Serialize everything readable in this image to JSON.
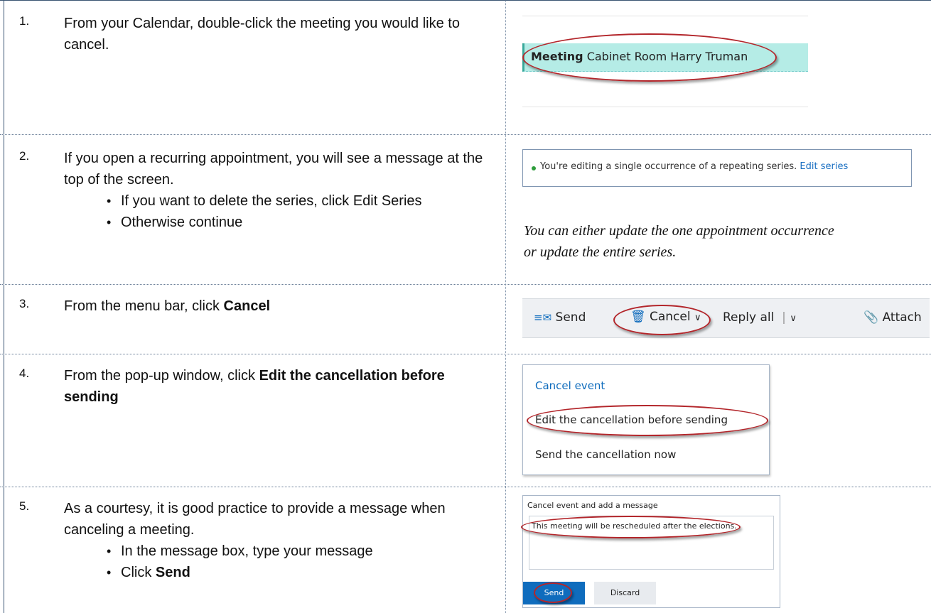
{
  "steps": [
    {
      "num": "1.",
      "text": "From your Calendar, double-click the meeting you would like to cancel."
    },
    {
      "num": "2.",
      "text": "If you open a recurring appointment, you will see a message at the top of the screen.",
      "bullets": [
        "If you want to delete the series, click Edit Series",
        "Otherwise continue"
      ]
    },
    {
      "num": "3.",
      "text_prefix": "From the menu bar, click ",
      "bold": "Cancel"
    },
    {
      "num": "4.",
      "text_prefix": "From the pop-up window, click ",
      "bold": "Edit the cancellation before sending"
    },
    {
      "num": "5.",
      "text": "As a courtesy, it is good practice to provide a message when canceling a meeting.",
      "bullets": [
        "In the message box, type your message"
      ],
      "last_prefix": "Click ",
      "last_bold": "Send"
    }
  ],
  "shot1": {
    "bold": "Meeting",
    "rest": "Cabinet Room Harry Truman",
    "bg": "#b5ece6"
  },
  "shot2": {
    "message": "You're editing a single occurrence of a repeating series.",
    "link": "Edit series",
    "dot_color": "#2e9d3c"
  },
  "note": "You can either update the one appointment occurrence or update the entire series.",
  "shot3": {
    "send": "Send",
    "cancel": "Cancel",
    "reply": "Reply all",
    "attach": "Attach",
    "icon_color": "#0f6cbd"
  },
  "shot4": {
    "title": "Cancel event",
    "option1": "Edit the cancellation before sending",
    "option2": "Send the cancellation now",
    "accent": "#0f6cbd"
  },
  "shot5": {
    "title": "Cancel event and add a message",
    "message": "This meeting will be rescheduled after the elections.",
    "send": "Send",
    "discard": "Discard",
    "accent": "#0f6cbd"
  }
}
